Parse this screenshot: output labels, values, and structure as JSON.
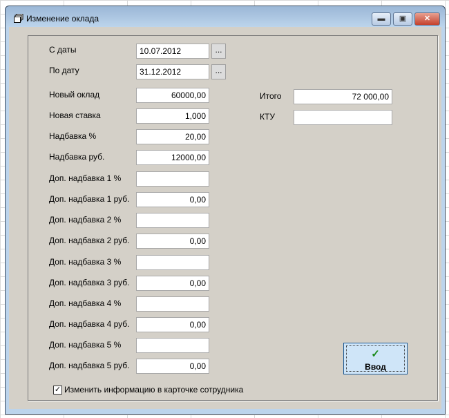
{
  "window": {
    "title": "Изменение оклада",
    "icon": "forms-icon"
  },
  "form": {
    "date_from": {
      "label": "С даты",
      "value": "10.07.2012",
      "button": "..."
    },
    "date_to": {
      "label": "По дату",
      "value": "31.12.2012",
      "button": "..."
    },
    "rows": [
      {
        "label": "Новый оклад",
        "value": "60000,00"
      },
      {
        "label": "Новая ставка",
        "value": "1,000"
      },
      {
        "label": "Надбавка %",
        "value": "20,00"
      },
      {
        "label": "Надбавка руб.",
        "value": "12000,00"
      },
      {
        "label": "Доп. надбавка 1 %",
        "value": ""
      },
      {
        "label": "Доп. надбавка 1 руб.",
        "value": "0,00"
      },
      {
        "label": "Доп. надбавка 2 %",
        "value": ""
      },
      {
        "label": "Доп. надбавка 2 руб.",
        "value": "0,00"
      },
      {
        "label": "Доп. надбавка 3 %",
        "value": ""
      },
      {
        "label": "Доп. надбавка 3 руб.",
        "value": "0,00"
      },
      {
        "label": "Доп. надбавка 4 %",
        "value": ""
      },
      {
        "label": "Доп. надбавка 4 руб.",
        "value": "0,00"
      },
      {
        "label": "Доп. надбавка 5 %",
        "value": ""
      },
      {
        "label": "Доп. надбавка 5 руб.",
        "value": "0,00"
      }
    ],
    "total": {
      "label": "Итого",
      "value": "72 000,00"
    },
    "ktu": {
      "label": "КТУ",
      "value": ""
    },
    "submit_label": "Ввод",
    "checkbox": {
      "label": "Изменить информацию в карточке сотрудника",
      "checked": true
    }
  }
}
